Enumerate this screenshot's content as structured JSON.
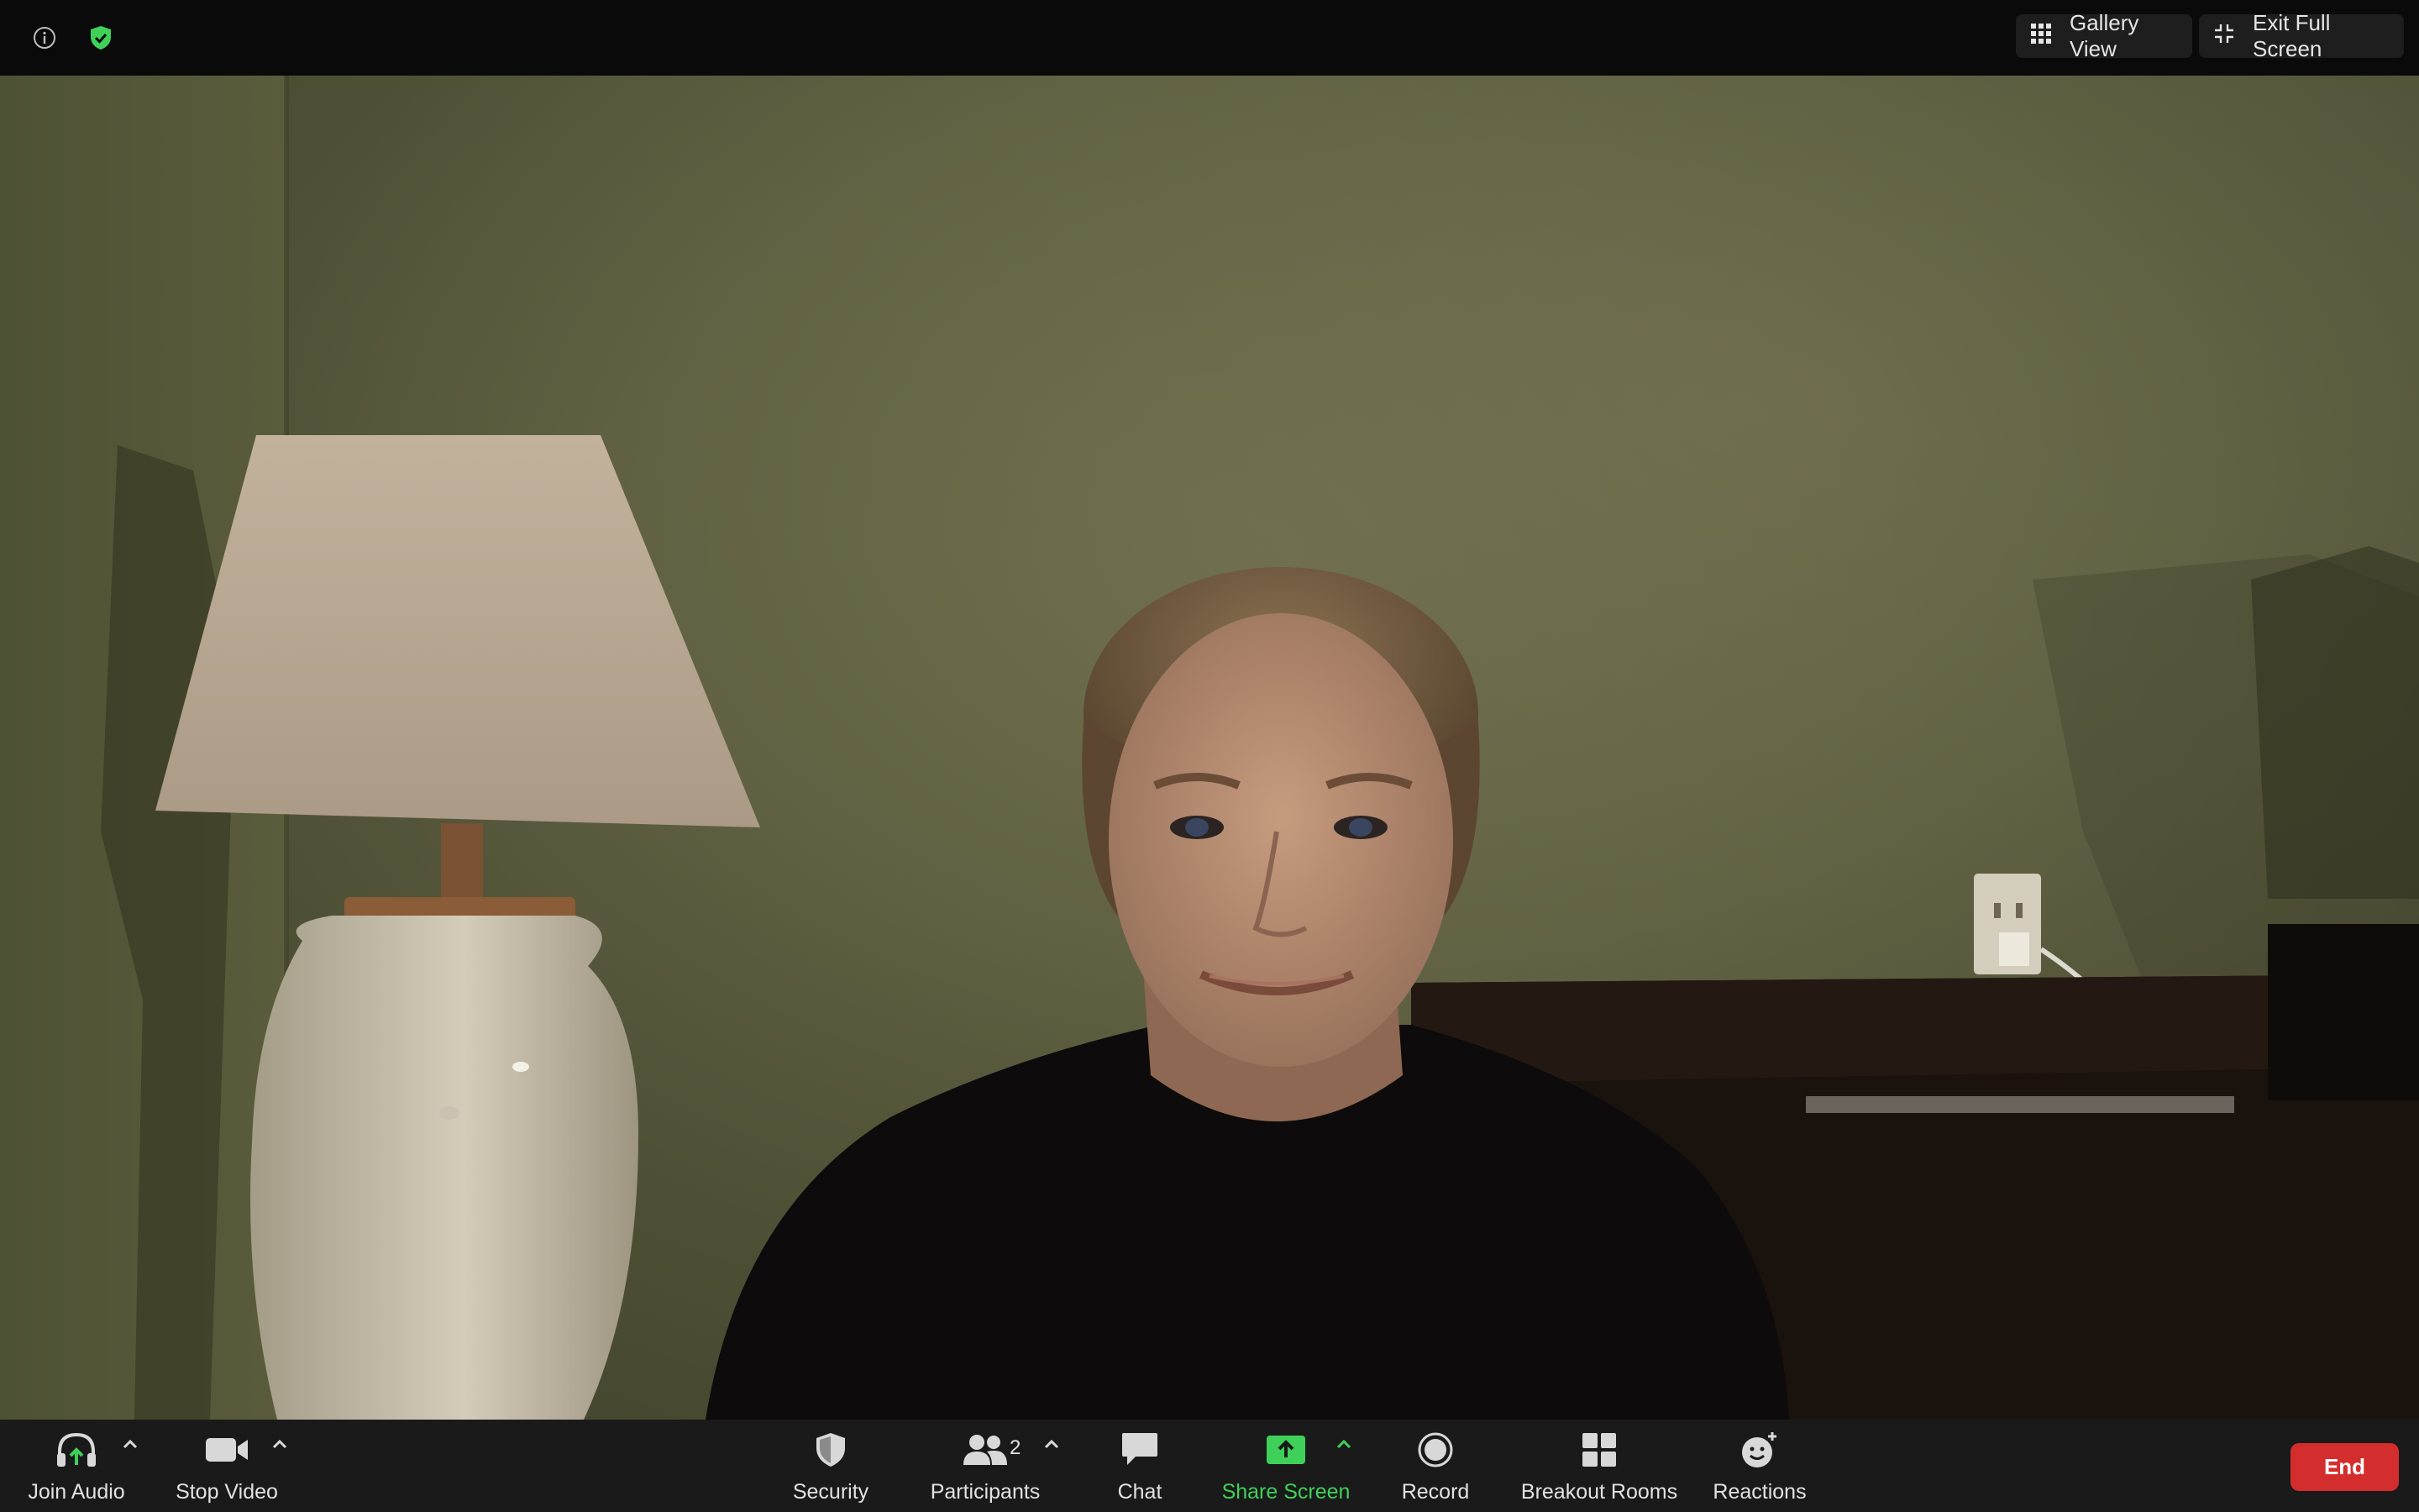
{
  "top_bar": {
    "info_icon": "info-icon",
    "security_status_icon": "shield-check-icon",
    "gallery_view_label": "Gallery View",
    "exit_full_screen_label": "Exit Full Screen"
  },
  "toolbar": {
    "join_audio": "Join Audio",
    "stop_video": "Stop Video",
    "security": "Security",
    "participants": "Participants",
    "participants_count": "2",
    "chat": "Chat",
    "share_screen": "Share Screen",
    "record": "Record",
    "breakout_rooms": "Breakout Rooms",
    "reactions": "Reactions",
    "end": "End"
  },
  "colors": {
    "share_screen_accent": "#3fd05a",
    "end_button": "#d42d2d",
    "shield_badge": "#3fd05a"
  }
}
